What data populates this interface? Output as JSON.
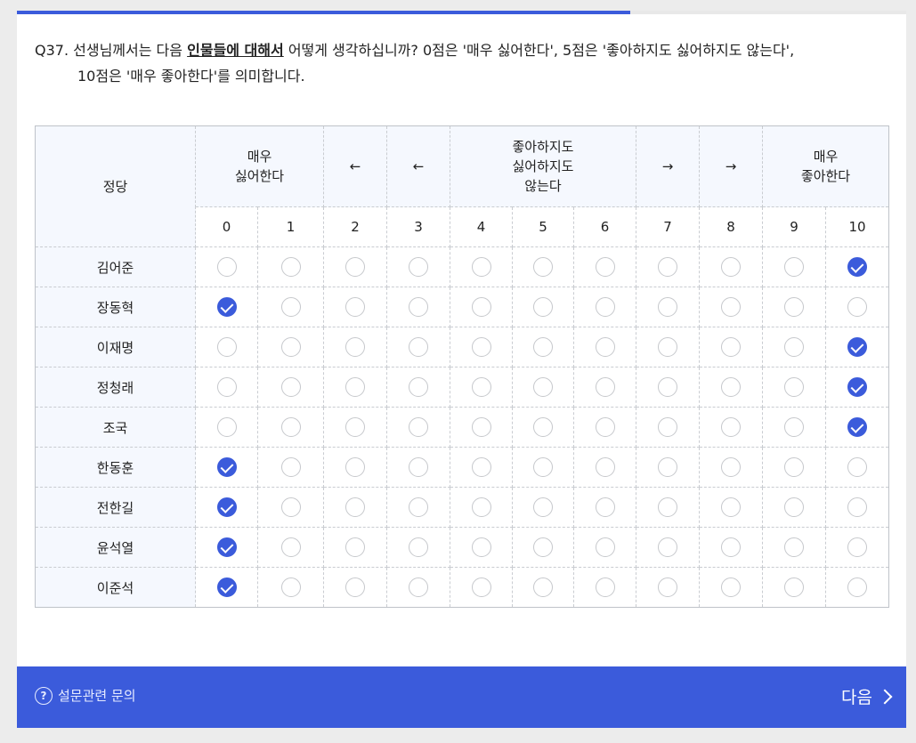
{
  "progress": {
    "percent": 69.0
  },
  "question": {
    "prefix": "Q37.",
    "text_before": "선생님께서는 다음",
    "emphasis": "인물들에 대해서",
    "text_after": "어떻게 생각하십니까? 0점은 '매우 싫어한다', 5점은 '좋아하지도 싫어하지도 않는다',",
    "line2": "10점은 '매우 좋아한다'를 의미합니다."
  },
  "table": {
    "corner_label": "정당",
    "headers": {
      "left_top": "매우",
      "left_bottom": "싫어한다",
      "arrow_left": "←",
      "mid_1": "좋아하지도",
      "mid_2": "싫어하지도",
      "mid_3": "않는다",
      "arrow_right": "→",
      "right_top": "매우",
      "right_bottom": "좋아한다"
    },
    "scale": [
      "0",
      "1",
      "2",
      "3",
      "4",
      "5",
      "6",
      "7",
      "8",
      "9",
      "10"
    ],
    "rows": [
      {
        "name": "김어준",
        "selected": 10
      },
      {
        "name": "장동혁",
        "selected": 0
      },
      {
        "name": "이재명",
        "selected": 10
      },
      {
        "name": "정청래",
        "selected": 10
      },
      {
        "name": "조국",
        "selected": 10
      },
      {
        "name": "한동훈",
        "selected": 0
      },
      {
        "name": "전한길",
        "selected": 0
      },
      {
        "name": "윤석열",
        "selected": 0
      },
      {
        "name": "이준석",
        "selected": 0
      }
    ]
  },
  "footer": {
    "help_icon": "?",
    "help_label": "설문관련 문의",
    "next_label": "다음"
  },
  "colors": {
    "accent": "#3b5bdb",
    "header_bg": "#f5f8fe"
  }
}
